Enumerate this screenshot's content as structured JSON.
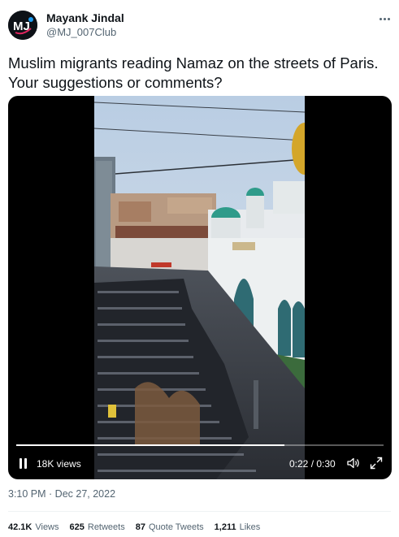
{
  "author": {
    "name": "Mayank Jindal",
    "handle": "@MJ_007Club",
    "avatar_icon": "mj-logo-avatar"
  },
  "tweet": {
    "text": "Muslim migrants reading Namaz on the streets of Paris.\nYour suggestions or comments?"
  },
  "video": {
    "views_label": "18K views",
    "current_time": "0:22",
    "duration": "0:30",
    "time_separator": " / ",
    "progress_fraction": 0.73,
    "icons": [
      "pause-icon",
      "volume-icon",
      "fullscreen-icon"
    ]
  },
  "meta": {
    "time": "3:10 PM",
    "separator": " · ",
    "date": "Dec 27, 2022"
  },
  "stats": {
    "views_value": "42.1K",
    "views_label": "Views",
    "retweets_value": "625",
    "retweets_label": "Retweets",
    "quotes_value": "87",
    "quotes_label": "Quote Tweets",
    "likes_value": "1,211",
    "likes_label": "Likes"
  },
  "colors": {
    "text_primary": "#0f1419",
    "text_secondary": "#536471",
    "divider": "#eff3f4"
  }
}
